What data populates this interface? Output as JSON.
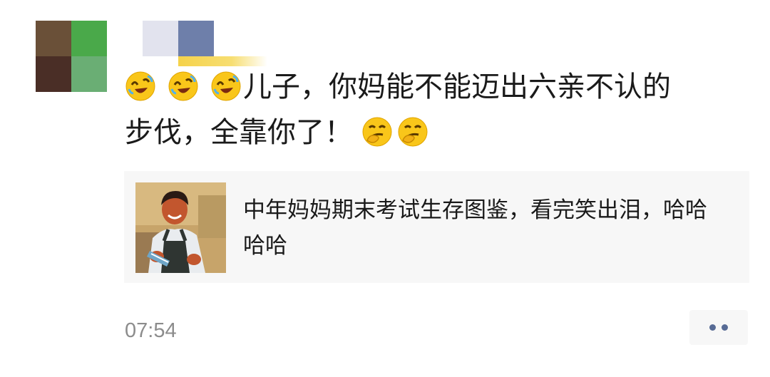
{
  "post": {
    "text_line1": "儿子，你妈能不能迈出六亲不认的",
    "text_line2": "步伐，全靠你了！",
    "leading_emoji": [
      "rofl-emoji",
      "rofl-emoji",
      "rofl-emoji"
    ],
    "trailing_emoji": [
      "smirk-emoji",
      "smirk-emoji"
    ],
    "avatar_colors": [
      "#6a5038",
      "#4aa94a",
      "#4a2e26",
      "#6aae74"
    ],
    "name_colors": [
      "#e2e3ee",
      "#6e7faa"
    ]
  },
  "link_card": {
    "title": "中年妈妈期末考试生存图鉴，看完笑出泪，哈哈哈哈",
    "thumbnail": "propaganda-poster-thumbnail"
  },
  "footer": {
    "timestamp": "07:54",
    "more_icon": "two-dots-icon",
    "link_color": "#576b95"
  }
}
